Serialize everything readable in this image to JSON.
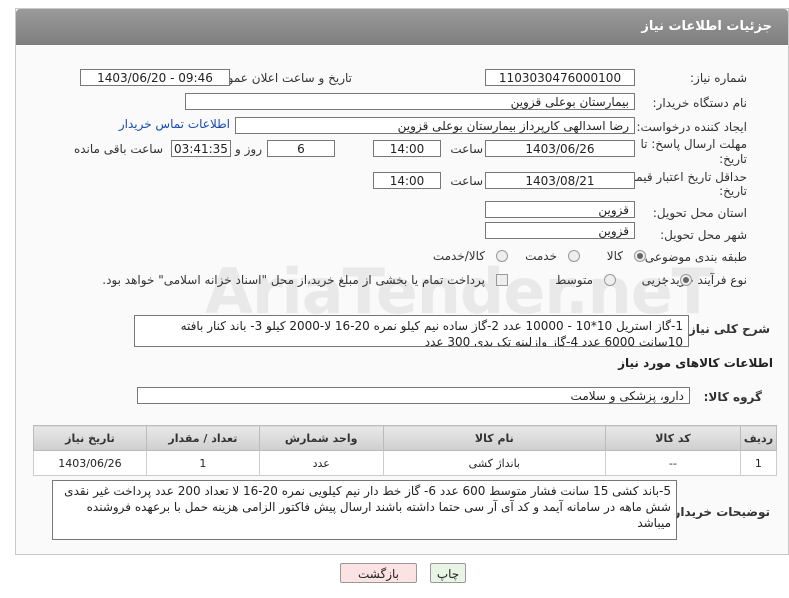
{
  "header": {
    "title": "جزئیات اطلاعات نیاز"
  },
  "fields": {
    "need_number_label": "شماره نیاز:",
    "need_number": "1103030476000100",
    "announce_label": "تاریخ و ساعت اعلان عمومی:",
    "announce_value": "1403/06/20 - 09:46",
    "buyer_org_label": "نام دستگاه خریدار:",
    "buyer_org": "بیمارستان بوعلی قزوین",
    "creator_label": "ایجاد کننده درخواست:",
    "creator": "رضا اسدالهی کارپرداز بیمارستان بوعلی قزوین",
    "contact_link": "اطلاعات تماس خریدار",
    "deadline_label": "مهلت ارسال پاسخ: تا",
    "deadline_label2": "تاریخ:",
    "deadline_date": "1403/06/26",
    "time_label": "ساعت",
    "deadline_time": "14:00",
    "days_value": "6",
    "days_label": "روز و",
    "remaining_time": "03:41:35",
    "remaining_label": "ساعت باقی مانده",
    "validity_label": "حداقل تاریخ اعتبار قیمت: تا",
    "validity_label2": "تاریخ:",
    "validity_date": "1403/08/21",
    "validity_time": "14:00",
    "province_label": "استان محل تحویل:",
    "province": "قزوین",
    "city_label": "شهر محل تحویل:",
    "city": "قزوین",
    "category_label": "طبقه بندی موضوعی:",
    "cat_goods": "کالا",
    "cat_service": "خدمت",
    "cat_goods_service": "کالا/خدمت",
    "purchase_label": "نوع فرآیند خرید :",
    "proc_minor": "جزیی",
    "proc_medium": "متوسط",
    "treasury_note": "پرداخت تمام یا بخشی از مبلغ خرید،از محل \"اسناد خزانه اسلامی\" خواهد بود."
  },
  "description": {
    "label": "شرح کلی نیاز:",
    "text": "1-گاز استریل 10*10 - 10000 عدد 2-گاز ساده نیم کیلو نمره 20-16 لا-2000 کیلو 3- باند کنار بافته 10سانت 6000 عدد 4-گاز وازلینه تک پدی 300 عدد"
  },
  "goods_section": {
    "title": "اطلاعات کالاهای مورد نیاز",
    "group_label": "گروه کالا:",
    "group_value": "دارو، پزشکی و سلامت"
  },
  "table": {
    "headers": [
      "ردیف",
      "کد کالا",
      "نام کالا",
      "واحد شمارش",
      "تعداد / مقدار",
      "تاریخ نیاز"
    ],
    "rows": [
      [
        "1",
        "--",
        "بانداژ کشی",
        "عدد",
        "1",
        "1403/06/26"
      ]
    ]
  },
  "buyer_notes": {
    "label": "توضیحات خریدار:",
    "text": "5-باند کشی 15 سانت فشار متوسط 600 عدد 6- گاز خط دار نیم کیلویی نمره 20-16 لا تعداد 200 عدد پرداخت غیر نقدی شش ماهه در سامانه آیمد و کد آی آر سی حتما داشته باشند ارسال پیش فاکتور الزامی هزینه حمل با برعهده فروشنده میباشد"
  },
  "buttons": {
    "back": "بازگشت",
    "print": "چاپ"
  },
  "watermark": "AriaTender.neT",
  "colors": {
    "header": "#8a8a8a",
    "link": "#1a4bb0",
    "back_button": "#fbe3e3"
  }
}
